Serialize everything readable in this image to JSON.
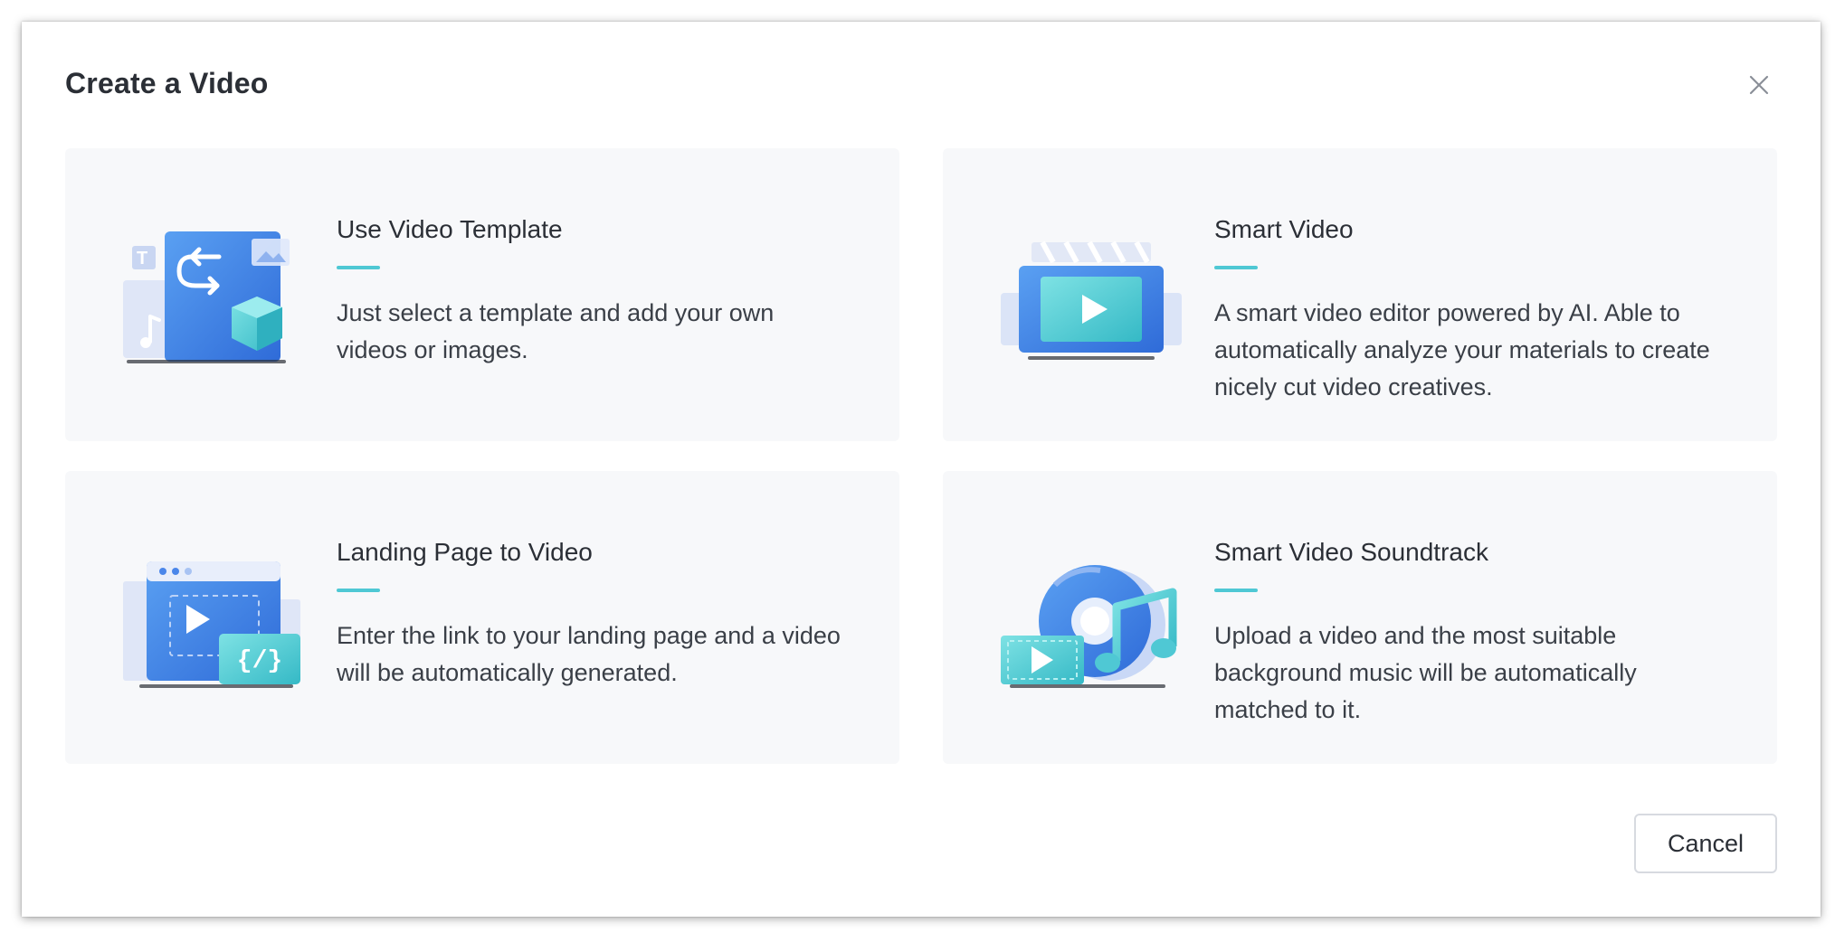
{
  "dialog": {
    "title": "Create a Video",
    "cancel_label": "Cancel"
  },
  "cards": [
    {
      "title": "Use Video Template",
      "description": "Just select a template and add your own videos or images.",
      "icon": "template-illustration-icon"
    },
    {
      "title": "Smart Video",
      "description": "A smart video editor powered by AI. Able to automatically analyze your materials to create nicely cut video creatives.",
      "icon": "smart-video-illustration-icon"
    },
    {
      "title": "Landing Page to Video",
      "description": "Enter the link to your landing page and a video will be automatically generated.",
      "icon": "landing-page-illustration-icon"
    },
    {
      "title": "Smart Video Soundtrack",
      "description": "Upload a video and the most suitable background music will be automatically matched to it.",
      "icon": "soundtrack-illustration-icon"
    }
  ],
  "colors": {
    "accent": "#4fc8d4",
    "card_bg": "#f7f8fa",
    "primary_blue": "#3f7fe6",
    "teal": "#4fc8d4"
  }
}
